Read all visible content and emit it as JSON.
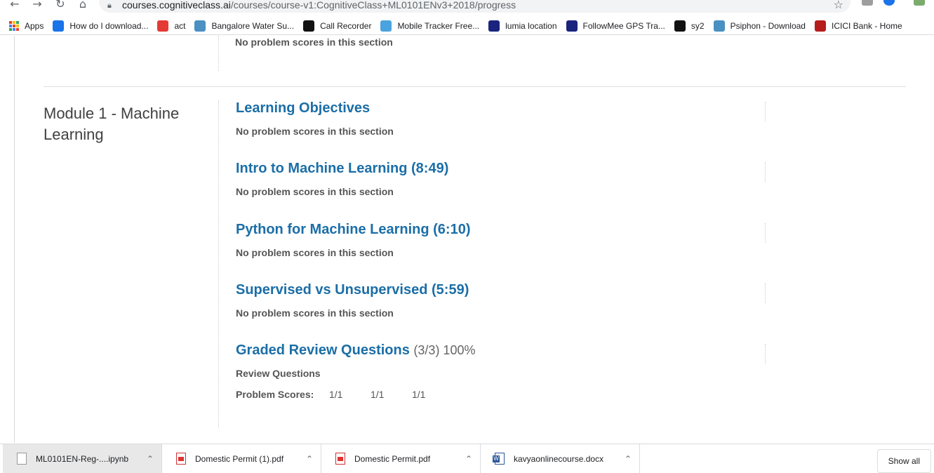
{
  "browser": {
    "url_host": "courses.cognitiveclass.ai",
    "url_path": "/courses/course-v1:CognitiveClass+ML0101ENv3+2018/progress",
    "bookmarks": [
      {
        "label": "Apps",
        "icon": "apps-grid-icon"
      },
      {
        "label": "How do I download...",
        "icon": "cw-icon",
        "color": "#1a73e8"
      },
      {
        "label": "act",
        "icon": "act-icon",
        "color": "#e53935"
      },
      {
        "label": "Bangalore Water Su...",
        "icon": "globe-icon",
        "color": "#4a90c2"
      },
      {
        "label": "Call Recorder",
        "icon": "app-icon",
        "color": "#111111"
      },
      {
        "label": "Mobile Tracker Free...",
        "icon": "tracker-icon",
        "color": "#4aa3df"
      },
      {
        "label": "lumia location",
        "icon": "location-icon",
        "color": "#1a237e"
      },
      {
        "label": "FollowMee GPS Tra...",
        "icon": "gps-icon",
        "color": "#1a237e"
      },
      {
        "label": "sy2",
        "icon": "app-icon",
        "color": "#111111"
      },
      {
        "label": "Psiphon - Download",
        "icon": "psiphon-icon",
        "color": "#4a90c2"
      },
      {
        "label": "ICICI Bank - Home",
        "icon": "icici-icon",
        "color": "#b71c1c"
      }
    ]
  },
  "progress": {
    "prev_no_scores": "No problem scores in this section",
    "module_title": "Module 1 - Machine Learning",
    "sections": [
      {
        "title": "Learning Objectives",
        "no_scores": "No problem scores in this section"
      },
      {
        "title": "Intro to Machine Learning (8:49)",
        "no_scores": "No problem scores in this section"
      },
      {
        "title": "Python for Machine Learning (6:10)",
        "no_scores": "No problem scores in this section"
      },
      {
        "title": "Supervised vs Unsupervised (5:59)",
        "no_scores": "No problem scores in this section"
      }
    ],
    "graded": {
      "title": "Graded Review Questions",
      "score": "(3/3) 100%",
      "subsection": "Review Questions",
      "scores_label": "Problem Scores:",
      "scores": [
        "1/1",
        "1/1",
        "1/1"
      ]
    }
  },
  "downloads": {
    "items": [
      {
        "name": "ML0101EN-Reg-....ipynb",
        "type": "file"
      },
      {
        "name": "Domestic Permit (1).pdf",
        "type": "pdf"
      },
      {
        "name": "Domestic Permit.pdf",
        "type": "pdf"
      },
      {
        "name": "kavyaonlinecourse.docx",
        "type": "docx"
      }
    ],
    "show_all": "Show all"
  },
  "colors": {
    "link": "#1b6ea7",
    "text": "#555555"
  }
}
